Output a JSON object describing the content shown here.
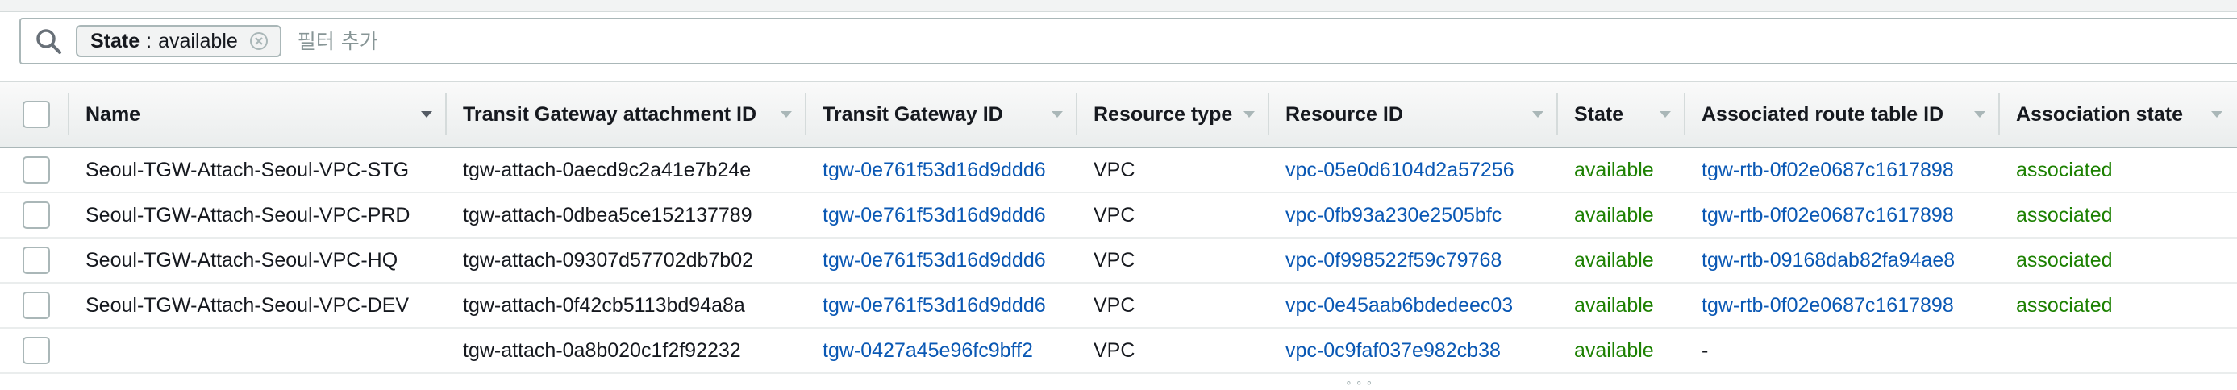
{
  "filter": {
    "token_key": "State",
    "token_sep": ":",
    "token_value": "available",
    "placeholder": "필터 추가"
  },
  "table": {
    "columns": [
      "Name",
      "Transit Gateway attachment ID",
      "Transit Gateway ID",
      "Resource type",
      "Resource ID",
      "State",
      "Associated route table ID",
      "Association state"
    ],
    "rows": [
      {
        "name": "Seoul-TGW-Attach-Seoul-VPC-STG",
        "attachment_id": "tgw-attach-0aecd9c2a41e7b24e",
        "tgw_id": "tgw-0e761f53d16d9ddd6",
        "resource_type": "VPC",
        "resource_id": "vpc-05e0d6104d2a57256",
        "state": "available",
        "route_table_id": "tgw-rtb-0f02e0687c1617898",
        "association_state": "associated"
      },
      {
        "name": "Seoul-TGW-Attach-Seoul-VPC-PRD",
        "attachment_id": "tgw-attach-0dbea5ce152137789",
        "tgw_id": "tgw-0e761f53d16d9ddd6",
        "resource_type": "VPC",
        "resource_id": "vpc-0fb93a230e2505bfc",
        "state": "available",
        "route_table_id": "tgw-rtb-0f02e0687c1617898",
        "association_state": "associated"
      },
      {
        "name": "Seoul-TGW-Attach-Seoul-VPC-HQ",
        "attachment_id": "tgw-attach-09307d57702db7b02",
        "tgw_id": "tgw-0e761f53d16d9ddd6",
        "resource_type": "VPC",
        "resource_id": "vpc-0f998522f59c79768",
        "state": "available",
        "route_table_id": "tgw-rtb-09168dab82fa94ae8",
        "association_state": "associated"
      },
      {
        "name": "Seoul-TGW-Attach-Seoul-VPC-DEV",
        "attachment_id": "tgw-attach-0f42cb5113bd94a8a",
        "tgw_id": "tgw-0e761f53d16d9ddd6",
        "resource_type": "VPC",
        "resource_id": "vpc-0e45aab6bdedeec03",
        "state": "available",
        "route_table_id": "tgw-rtb-0f02e0687c1617898",
        "association_state": "associated"
      },
      {
        "name": "",
        "attachment_id": "tgw-attach-0a8b020c1f2f92232",
        "tgw_id": "tgw-0427a45e96fc9bff2",
        "resource_type": "VPC",
        "resource_id": "vpc-0c9faf037e982cb38",
        "state": "available",
        "route_table_id": "-",
        "association_state": ""
      }
    ]
  },
  "icons": {
    "search": "search-icon",
    "token_remove": "close-circle-icon",
    "sort": "caret-down-icon"
  },
  "colors": {
    "link": "#0a58b4",
    "status_ok": "#1d8102",
    "border": "#aab7b8"
  }
}
